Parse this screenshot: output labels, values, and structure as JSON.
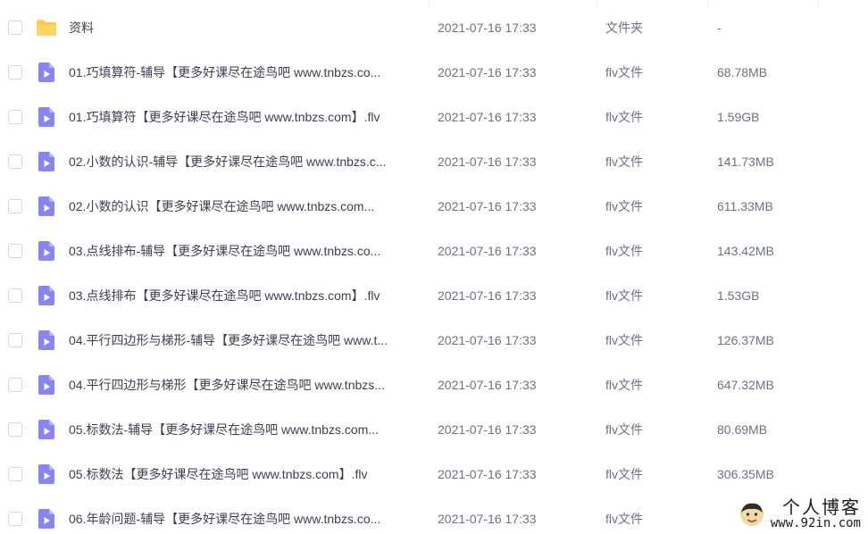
{
  "files": [
    {
      "name": "资料",
      "time": "2021-07-16 17:33",
      "type": "文件夹",
      "size": "-",
      "icon": "folder-icon"
    },
    {
      "name": "01.巧填算符-辅导【更多好课尽在途鸟吧 www.tnbzs.co...",
      "time": "2021-07-16 17:33",
      "type": "flv文件",
      "size": "68.78MB",
      "icon": "video-file-icon"
    },
    {
      "name": "01.巧填算符【更多好课尽在途鸟吧 www.tnbzs.com】.flv",
      "time": "2021-07-16 17:33",
      "type": "flv文件",
      "size": "1.59GB",
      "icon": "video-file-icon"
    },
    {
      "name": "02.小数的认识-辅导【更多好课尽在途鸟吧 www.tnbzs.c...",
      "time": "2021-07-16 17:33",
      "type": "flv文件",
      "size": "141.73MB",
      "icon": "video-file-icon"
    },
    {
      "name": "02.小数的认识【更多好课尽在途鸟吧 www.tnbzs.com...",
      "time": "2021-07-16 17:33",
      "type": "flv文件",
      "size": "611.33MB",
      "icon": "video-file-icon"
    },
    {
      "name": "03.点线排布-辅导【更多好课尽在途鸟吧 www.tnbzs.co...",
      "time": "2021-07-16 17:33",
      "type": "flv文件",
      "size": "143.42MB",
      "icon": "video-file-icon"
    },
    {
      "name": "03.点线排布【更多好课尽在途鸟吧 www.tnbzs.com】.flv",
      "time": "2021-07-16 17:33",
      "type": "flv文件",
      "size": "1.53GB",
      "icon": "video-file-icon"
    },
    {
      "name": "04.平行四边形与梯形-辅导【更多好课尽在途鸟吧 www.t...",
      "time": "2021-07-16 17:33",
      "type": "flv文件",
      "size": "126.37MB",
      "icon": "video-file-icon"
    },
    {
      "name": "04.平行四边形与梯形【更多好课尽在途鸟吧 www.tnbzs...",
      "time": "2021-07-16 17:33",
      "type": "flv文件",
      "size": "647.32MB",
      "icon": "video-file-icon"
    },
    {
      "name": "05.标数法-辅导【更多好课尽在途鸟吧 www.tnbzs.com...",
      "time": "2021-07-16 17:33",
      "type": "flv文件",
      "size": "80.69MB",
      "icon": "video-file-icon"
    },
    {
      "name": "05.标数法【更多好课尽在途鸟吧 www.tnbzs.com】.flv",
      "time": "2021-07-16 17:33",
      "type": "flv文件",
      "size": "306.35MB",
      "icon": "video-file-icon"
    },
    {
      "name": "06.年龄问题-辅导【更多好课尽在途鸟吧 www.tnbzs.co...",
      "time": "2021-07-16 17:33",
      "type": "flv文件",
      "size": "",
      "icon": "video-file-icon"
    }
  ],
  "watermark": {
    "title": "个人博客",
    "url": "www.92in.com",
    "icon": "avatar-icon"
  },
  "colors": {
    "folder": "#ffc94a",
    "video_file": "#8a85f0",
    "text_primary": "#3b4151",
    "text_secondary": "#6a7285"
  }
}
